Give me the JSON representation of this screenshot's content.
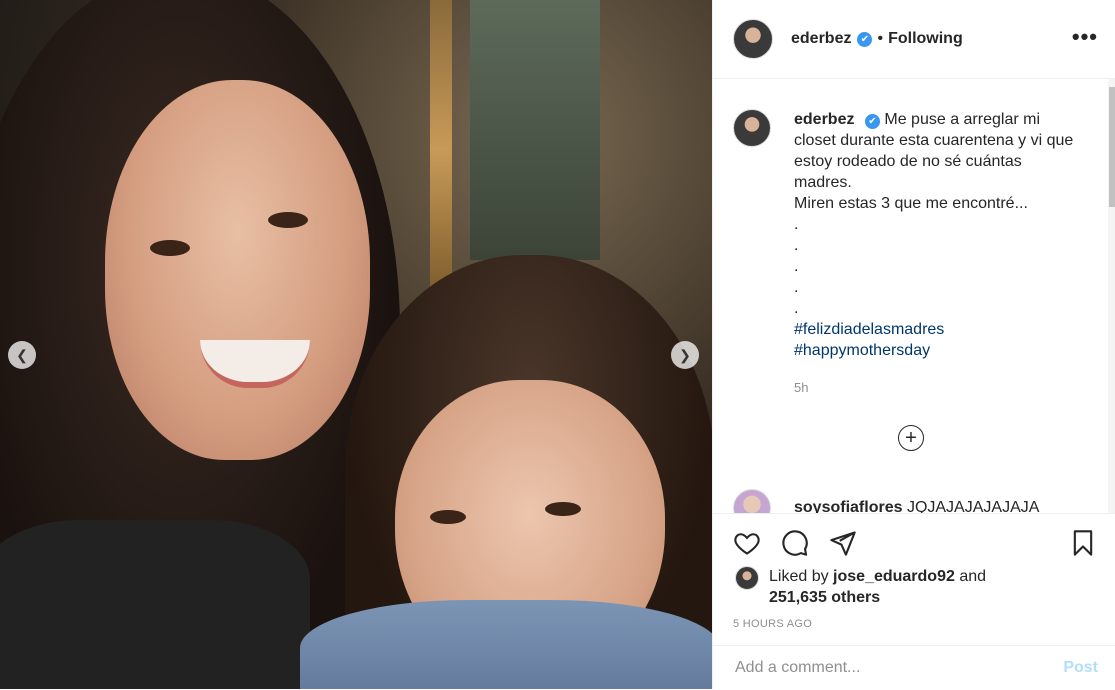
{
  "post": {
    "username": "ederbez",
    "verified_mark": "✔",
    "separator": "•",
    "follow_status": "Following",
    "more_label": "•••"
  },
  "caption": {
    "username": "ederbez",
    "text_line1": "Me puse a arreglar mi closet durante esta cuarentena y vi que estoy rodeado de no sé cuántas madres.",
    "text_line2": "Miren estas 3 que me encontré...",
    "dots": [
      ".",
      ".",
      ".",
      ".",
      "."
    ],
    "hashtags": [
      "#felizdiadelasmadres",
      "#happymothersday"
    ],
    "time": "5h"
  },
  "load_more": "+",
  "comment": {
    "username": "soysofiaflores",
    "text": "JQJAJAJAJAJAJA"
  },
  "likes": {
    "prefix": "Liked by",
    "user": "jose_eduardo92",
    "and": "and",
    "others": "251,635 others"
  },
  "posted_ago": "5 HOURS AGO",
  "comment_input": {
    "placeholder": "Add a comment...",
    "post_label": "Post"
  },
  "nav": {
    "prev": "❮",
    "next": "❯"
  },
  "colors": {
    "link": "#00376b",
    "verified": "#3897f0",
    "post_disabled": "#b2dffc"
  }
}
